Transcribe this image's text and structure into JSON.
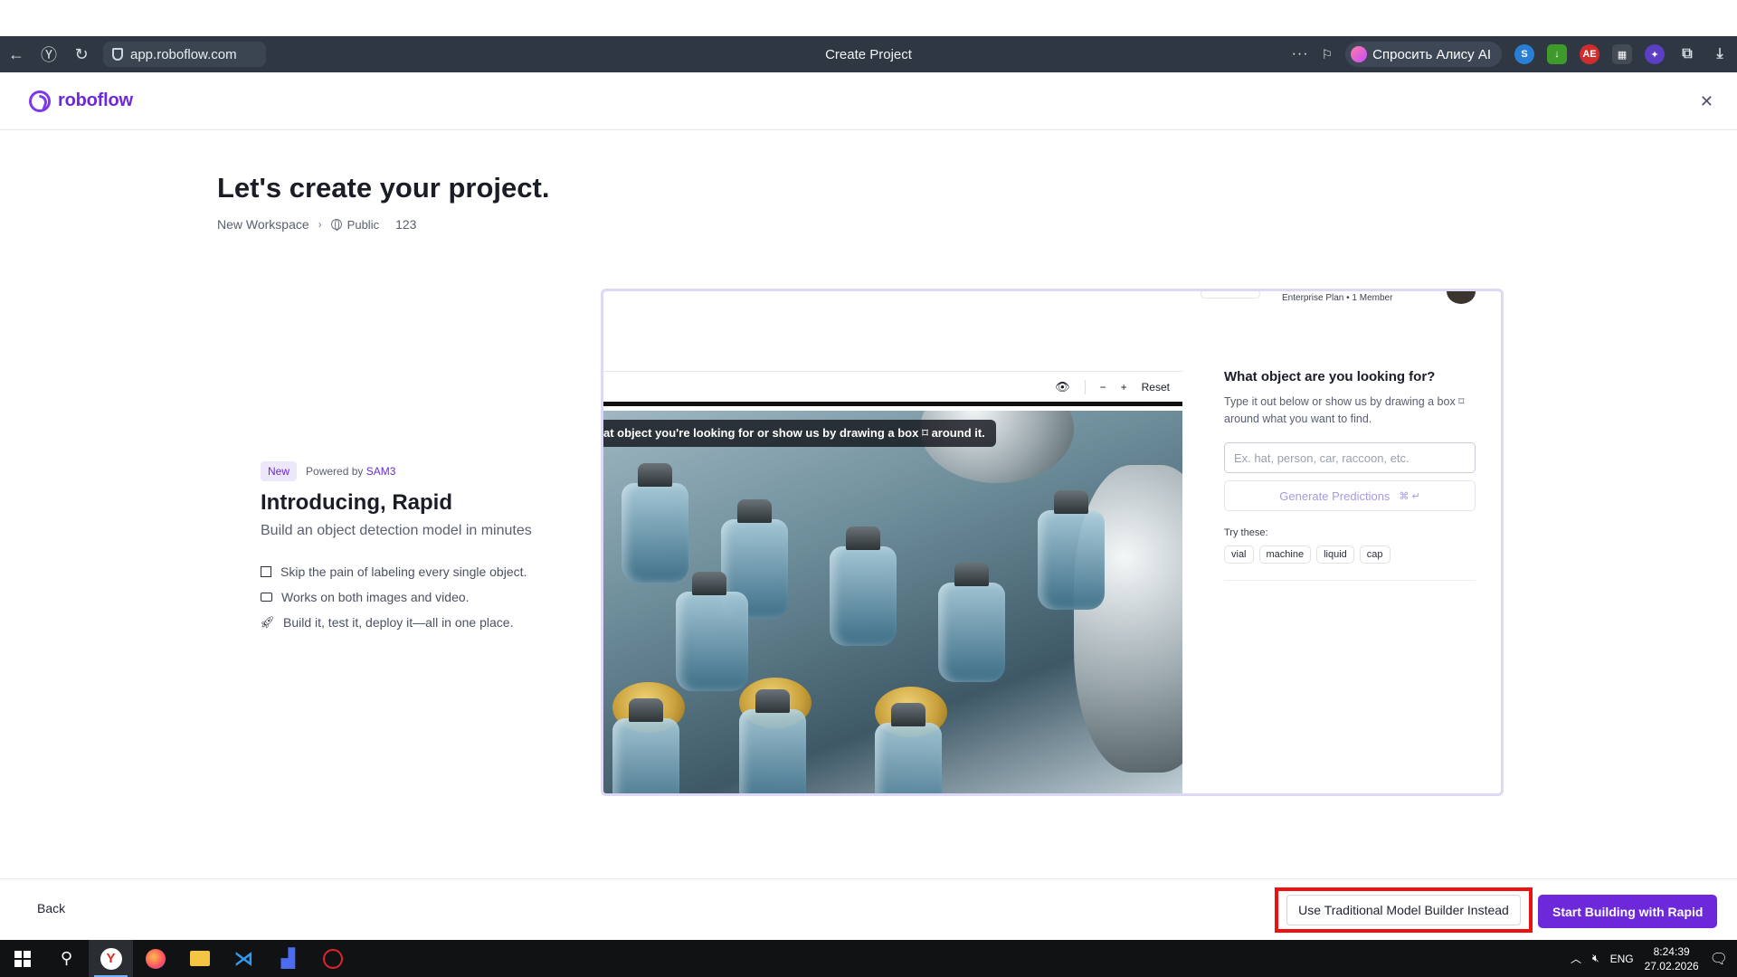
{
  "browser": {
    "url": "app.roboflow.com",
    "tab_title": "Create Project",
    "alisa_label": "Спросить Алису AI",
    "more_icon": "more-dots-icon"
  },
  "app": {
    "logo_text": "roboflow",
    "close_icon": "close-icon"
  },
  "page": {
    "title": "Let's create your project.",
    "workspace": "New Workspace",
    "visibility": "Public",
    "project_name": "123"
  },
  "intro": {
    "badge": "New",
    "powered_prefix": "Powered by",
    "powered_model": "SAM3",
    "heading": "Introducing, Rapid",
    "subheading": "Build an object detection model in minutes",
    "features": [
      "Skip the pain of labeling every single object.",
      "Works on both images and video.",
      "Build it, test it, deploy it—all in one place."
    ]
  },
  "preview": {
    "plan_meta": "Enterprise Plan • 1 Member",
    "toolbar_reset": "Reset",
    "banner_text": "at object you're looking for or show us by drawing a box ⌑ around it.",
    "panel_title": "What object are you looking for?",
    "panel_desc": "Type it out below or show us by drawing a box ⌑ around what you want to find.",
    "input_placeholder": "Ex. hat, person, car, raccoon, etc.",
    "generate_label": "Generate Predictions",
    "generate_shortcut": "⌘ ↵",
    "try_label": "Try these:",
    "chips": [
      "vial",
      "machine",
      "liquid",
      "cap"
    ]
  },
  "footer": {
    "back": "Back",
    "traditional": "Use Traditional Model Builder Instead",
    "rapid": "Start Building with Rapid",
    "accent_color": "#6d28d9",
    "highlight_color": "#ee1111"
  },
  "taskbar": {
    "lang": "ENG",
    "time": "8:24:39",
    "date": "27.02.2026"
  }
}
